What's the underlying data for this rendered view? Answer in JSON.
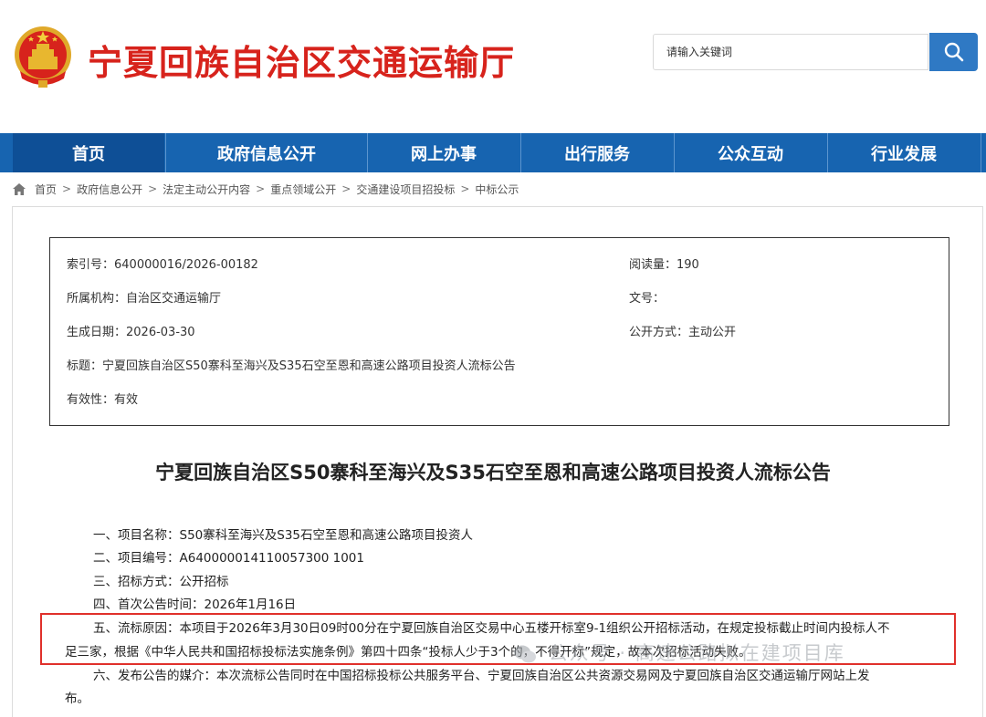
{
  "header": {
    "site_title": "宁夏回族自治区交通运输厅",
    "search_placeholder": "请输入关键词",
    "brand_color": "#d7231c",
    "search_button_icon": "search-icon"
  },
  "nav": {
    "items": [
      "首页",
      "政府信息公开",
      "网上办事",
      "出行服务",
      "公众互动",
      "行业发展"
    ],
    "active": "首页",
    "bg_color": "#1764b0"
  },
  "breadcrumb": {
    "home_icon": "home-icon",
    "items": [
      "首页",
      "政府信息公开",
      "法定主动公开内容",
      "重点领域公开",
      "交通建设项目招投标",
      "中标公示"
    ],
    "separator": ">"
  },
  "meta": {
    "index_no": "索引号：640000016/2026-00182",
    "read_count": "阅读量：190",
    "agency": "所属机构：自治区交通运输厅",
    "doc_no": "文号：",
    "date": "生成日期：2026-03-30",
    "disclosure": "公开方式：主动公开",
    "title": "标题：宁夏回族自治区S50寨科至海兴及S35石空至恩和高速公路项目投资人流标公告",
    "validity": "有效性：有效"
  },
  "article": {
    "title": "宁夏回族自治区S50寨科至海兴及S35石空至恩和高速公路项目投资人流标公告",
    "paragraphs": [
      "一、项目名称：S50寨科至海兴及S35石空至恩和高速公路项目投资人",
      "二、项目编号：A640000014110057300 1001",
      "三、招标方式：公开招标",
      "四、首次公告时间：2026年1月16日",
      "五、流标原因：本项目于2026年3月30日09时00分在宁夏回族自治区交易中心五楼开标室9-1组织公开招标活动，在规定投标截止时间内投标人不",
      "足三家，根据《中华人民共和国招标投标法实施条例》第四十四条“投标人少于3个的，不得开标”规定，故本次招标活动失败。",
      "六、发布公告的媒介：本次流标公告同时在中国招标投标公共服务平台、宁夏回族自治区公共资源交易网及宁夏回族自治区交通运输厅网站上发",
      "布。"
    ],
    "highlight_color": "#e0302b"
  },
  "watermark": {
    "text": "公众号 · 高速公路拟在建项目库"
  }
}
